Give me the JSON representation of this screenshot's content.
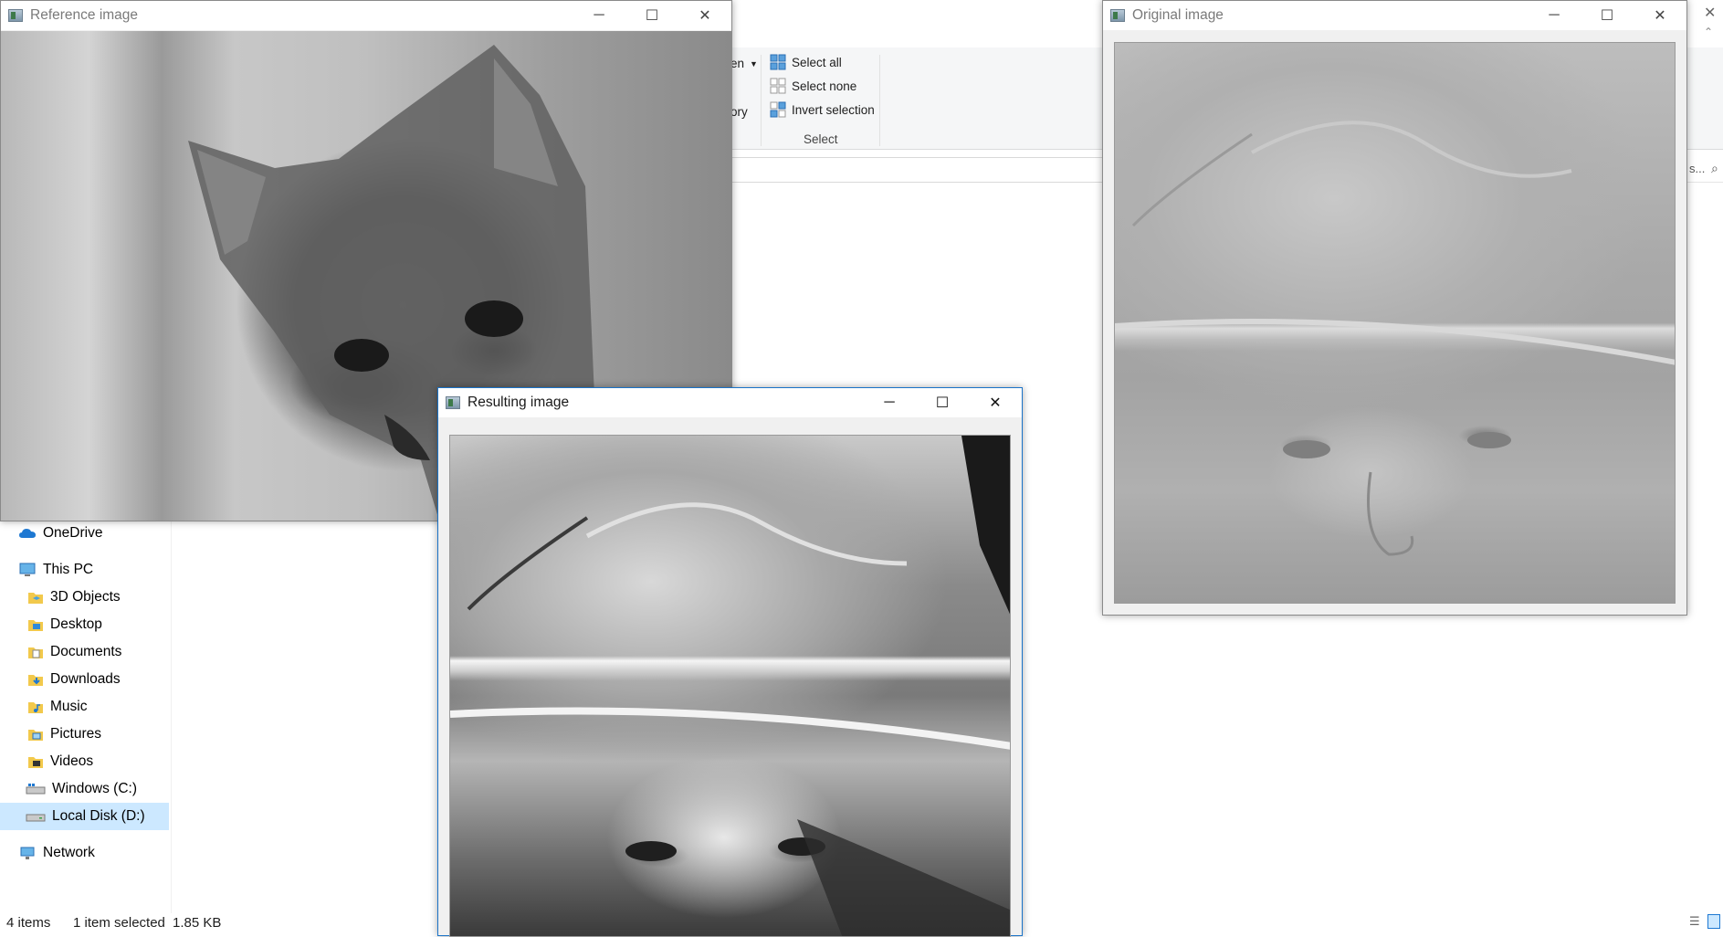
{
  "explorer": {
    "ribbon": {
      "partial_left_1": "en",
      "partial_left_2": "ory",
      "select_all": "Select all",
      "select_none": "Select none",
      "invert_selection": "Invert selection",
      "group_label": "Select",
      "search_partial": "s..."
    },
    "nav": {
      "items": [
        {
          "label": "OneDrive",
          "icon": "onedrive-cloud-icon"
        },
        {
          "label": "This PC",
          "icon": "computer-icon"
        },
        {
          "label": "3D Objects",
          "icon": "3d-objects-folder-icon"
        },
        {
          "label": "Desktop",
          "icon": "desktop-folder-icon"
        },
        {
          "label": "Documents",
          "icon": "documents-folder-icon"
        },
        {
          "label": "Downloads",
          "icon": "downloads-folder-icon"
        },
        {
          "label": "Music",
          "icon": "music-folder-icon"
        },
        {
          "label": "Pictures",
          "icon": "pictures-folder-icon"
        },
        {
          "label": "Videos",
          "icon": "videos-folder-icon"
        },
        {
          "label": "Windows (C:)",
          "icon": "windows-drive-icon"
        },
        {
          "label": "Local Disk (D:)",
          "icon": "local-disk-icon"
        },
        {
          "label": "Network",
          "icon": "network-icon"
        }
      ],
      "selected": "Local Disk (D:)"
    },
    "status": {
      "item_count": "4 items",
      "selection": "1 item selected",
      "size": "1.85 KB"
    }
  },
  "windows": {
    "reference": {
      "title": "Reference image"
    },
    "original": {
      "title": "Original image"
    },
    "resulting": {
      "title": "Resulting image"
    }
  },
  "colors": {
    "active_border": "#1a73c8",
    "selected_nav": "#cce8ff",
    "accent_blue": "#0078d7"
  }
}
